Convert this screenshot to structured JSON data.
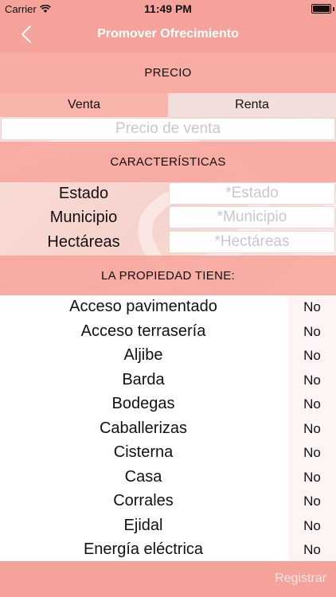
{
  "status_bar": {
    "carrier": "Carrier",
    "time": "11:49 PM"
  },
  "nav": {
    "title": "Promover Ofrecimiento",
    "back_icon": "chevron-left-icon"
  },
  "price_section": {
    "header": "PRECIO",
    "segments": [
      {
        "label": "Venta",
        "selected": true
      },
      {
        "label": "Renta",
        "selected": false
      }
    ],
    "price_input": {
      "value": "",
      "placeholder": "Precio de venta"
    }
  },
  "characteristics": {
    "header": "CARACTERÍSTICAS",
    "fields": [
      {
        "label": "Estado",
        "placeholder": "*Estado"
      },
      {
        "label": "Municipio",
        "placeholder": "*Municipio"
      },
      {
        "label": "Hectáreas",
        "placeholder": "*Hectáreas"
      }
    ]
  },
  "amenities": {
    "header": "LA PROPIEDAD TIENE:",
    "items": [
      {
        "label": "Acceso pavimentado",
        "value": "No"
      },
      {
        "label": "Acceso terrasería",
        "value": "No"
      },
      {
        "label": "Aljibe",
        "value": "No"
      },
      {
        "label": "Barda",
        "value": "No"
      },
      {
        "label": "Bodegas",
        "value": "No"
      },
      {
        "label": "Caballerizas",
        "value": "No"
      },
      {
        "label": "Cisterna",
        "value": "No"
      },
      {
        "label": "Casa",
        "value": "No"
      },
      {
        "label": "Corrales",
        "value": "No"
      },
      {
        "label": "Ejidal",
        "value": "No"
      },
      {
        "label": "Energía eléctrica",
        "value": "No"
      }
    ]
  },
  "footer": {
    "register_label": "Registrar"
  },
  "colors": {
    "accent": "#f5a39a",
    "segment_active": "#f9b4ab",
    "segment_inactive": "#f2dedb"
  }
}
